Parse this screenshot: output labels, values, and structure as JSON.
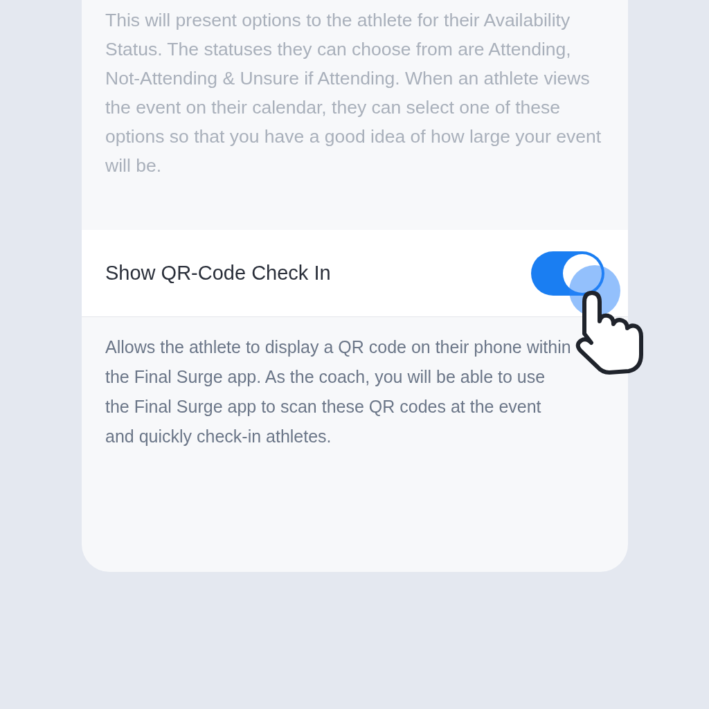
{
  "intro": {
    "text": "This will present options to the athlete for their Availability Status. The statuses they can choose from are Attending, Not-Attending & Unsure if Attending. When an athlete views the event on their calendar, they can select one of these options so that you have a good idea of how large your event will be.",
    "blurred": true
  },
  "settings": [
    {
      "label": "Show QR-Code Check In",
      "on": true,
      "description": "Allows the athlete to display a QR code on their phone within the Final Surge app. As the coach, you will be able to use the Final Surge app to scan these QR codes at the event and quickly check-in athletes."
    }
  ]
}
